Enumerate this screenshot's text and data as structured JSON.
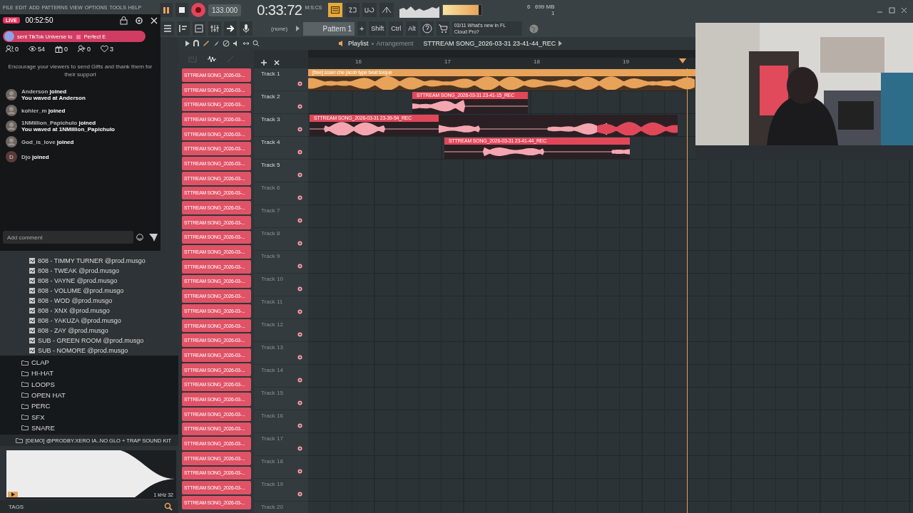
{
  "menu": [
    "FILE",
    "EDIT",
    "ADD",
    "PATTERNS",
    "VIEW",
    "OPTIONS",
    "TOOLS",
    "HELP"
  ],
  "transport": {
    "tempo": "133.000",
    "time": "0:33:72",
    "time_unit": "M:S:CS",
    "cpu": "6",
    "memory": "699 MB",
    "polyphony": "1",
    "meter": {
      "level": 0.93
    }
  },
  "toolbar": {
    "channel": "(none)",
    "pattern": "Pattern 1",
    "add": "+",
    "keys": [
      "Shift",
      "Ctrl",
      "Alt"
    ],
    "news": "03/11  What's new in FL Cloud Pro?"
  },
  "browser": {
    "items": [
      {
        "label": "808 - TIMMY TURNER @prod.musgo",
        "kind": "file"
      },
      {
        "label": "808 - TWEAK @prod.musgo",
        "kind": "file"
      },
      {
        "label": "808 - VAYNE @prod.musgo",
        "kind": "file"
      },
      {
        "label": "808 - VOLUME @prod.musgo",
        "kind": "file"
      },
      {
        "label": "808 - WOD @prod.musgo",
        "kind": "file"
      },
      {
        "label": "808 - XNX @prod.musgo",
        "kind": "file"
      },
      {
        "label": "808 - YAKUZA @prod.musgo",
        "kind": "file"
      },
      {
        "label": "808 - ZAY @prod.musgo",
        "kind": "file"
      },
      {
        "label": "SUB - GREEN ROOM @prod.musgo",
        "kind": "file"
      },
      {
        "label": "SUB - NOMORE @prod.musgo",
        "kind": "file"
      },
      {
        "label": "CLAP",
        "kind": "folder"
      },
      {
        "label": "HI-HAT",
        "kind": "folder"
      },
      {
        "label": "LOOPS",
        "kind": "folder"
      },
      {
        "label": "OPEN HAT",
        "kind": "folder"
      },
      {
        "label": "PERC",
        "kind": "folder"
      },
      {
        "label": "SFX",
        "kind": "folder"
      },
      {
        "label": "SNARE",
        "kind": "folder"
      },
      {
        "label": "[DEMO] @PRODBY.XERO IA..NO GLO + TRAP SOUND KIT",
        "kind": "kit"
      }
    ],
    "preview_info": "1 kHz 32",
    "tags": "TAGS"
  },
  "channels": [
    "STTREAM SONG_2026-03-...",
    "STTREAM SONG_2026-03-...",
    "STTREAM SONG_2026-03-...",
    "STTREAM SONG_2026-03-...",
    "STTREAM SONG_2026-03-...",
    "STTREAM SONG_2026-03-...",
    "STTREAM SONG_2026-03-...",
    "STTREAM SONG_2026-03-...",
    "STTREAM SONG_2026-03-...",
    "STTREAM SONG_2026-03-...",
    "STTREAM SONG_2026-03-...",
    "STTREAM SONG_2026-03-...",
    "STTREAM SONG_2026-03-...",
    "STTREAM SONG_2026-03-...",
    "STTREAM SONG_2026-03-...",
    "STTREAM SONG_2026-03-...",
    "STTREAM SONG_2026-03-...",
    "STTREAM SONG_2026-03-...",
    "STTREAM SONG_2026-03-...",
    "STTREAM SONG_2026-03-...",
    "STTREAM SONG_2026-03-...",
    "STTREAM SONG_2026-03-...",
    "STTREAM SONG_2026-03-...",
    "STTREAM SONG_2026-03-...",
    "STTREAM SONG_2026-03-...",
    "STTREAM SONG_2026-03-...",
    "STTREAM SONG_2026-03-...",
    "STTREAM SONG_2026-03-...",
    "STTREAM SONG_2026-03-...",
    "STTREAM SONG_2026-03-..."
  ],
  "playlist": {
    "title": "Playlist",
    "view": "Arrangement",
    "arrangement": "STTREAM SONG_2026-03-31 23-41-44_REC",
    "bars": [
      "16",
      "17",
      "18",
      "19"
    ],
    "tracks": [
      {
        "name": "Track 1",
        "dim": false,
        "clips": [
          {
            "label": "[free] soser  che  jacob type beat torque",
            "color": "#e8a35a"
          }
        ]
      },
      {
        "name": "Track 2",
        "dim": false,
        "clips": [
          {
            "label": "STTREAM SONG_2026-03-31 23-41-15_REC",
            "color": "#e0485a"
          }
        ]
      },
      {
        "name": "Track 3",
        "dim": false,
        "clips": [
          {
            "label": "STTREAM SONG_2026-03-31 23-39-54_REC",
            "color": "#e0485a"
          },
          {
            "color": "#e0485a"
          }
        ]
      },
      {
        "name": "Track 4",
        "dim": false,
        "clips": [
          {
            "label": "STTREAM SONG_2026-03-31 23-41-44_REC",
            "color": "#e0485a"
          }
        ]
      },
      {
        "name": "Track 5",
        "dim": false
      },
      {
        "name": "Track 6",
        "dim": true
      },
      {
        "name": "Track 7",
        "dim": true
      },
      {
        "name": "Track 8",
        "dim": true
      },
      {
        "name": "Track 9",
        "dim": true
      },
      {
        "name": "Track 10",
        "dim": true
      },
      {
        "name": "Track 11",
        "dim": true
      },
      {
        "name": "Track 12",
        "dim": true
      },
      {
        "name": "Track 13",
        "dim": true
      },
      {
        "name": "Track 14",
        "dim": true
      },
      {
        "name": "Track 15",
        "dim": true
      },
      {
        "name": "Track 16",
        "dim": true
      },
      {
        "name": "Track 17",
        "dim": true
      },
      {
        "name": "Track 18",
        "dim": true
      },
      {
        "name": "Track 19",
        "dim": true
      },
      {
        "name": "Track 20",
        "dim": true
      }
    ]
  },
  "live_overlay": {
    "badge": "LIVE",
    "duration": "00:52:50",
    "gift": {
      "text": "sent TikTok Universe to",
      "recipient": "Perfect E"
    },
    "stats": [
      {
        "kind": "people",
        "value": "0"
      },
      {
        "kind": "viewers",
        "value": "54"
      },
      {
        "kind": "gifts",
        "value": "0"
      },
      {
        "kind": "follows",
        "value": "0"
      },
      {
        "kind": "likes",
        "value": "3"
      }
    ],
    "tip": "Encourage your viewers to send Gifts and thank them for their support",
    "events": [
      {
        "user": "Anderson",
        "action": "joined",
        "note": "You waved at Anderson"
      },
      {
        "user": "kohler_m",
        "action": "joined"
      },
      {
        "user": "1NMillion_Papichulo",
        "action": "joined",
        "note": "You waved at 1NMillion_Papichulo"
      },
      {
        "user": "God_is_love",
        "action": "joined"
      },
      {
        "user": "Djo",
        "action": "joined",
        "initial": "D"
      }
    ],
    "comment_placeholder": "Add comment"
  }
}
